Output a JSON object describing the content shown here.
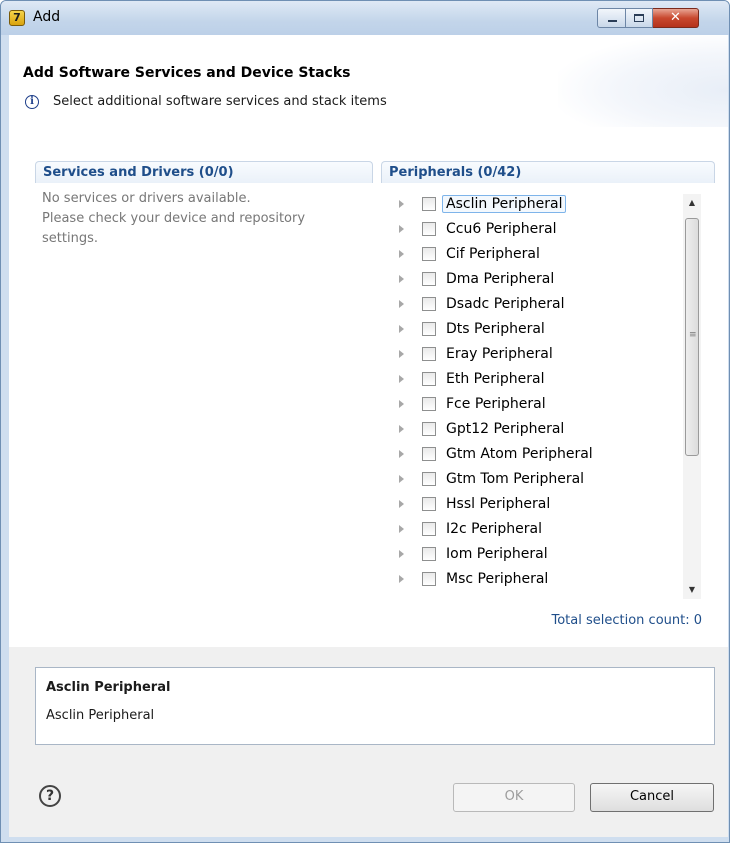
{
  "window": {
    "title": "Add",
    "app_icon_glyph": "7",
    "controls": {
      "minimize_icon": "minimize-icon",
      "maximize_icon": "maximize-icon",
      "close_icon": "close-icon",
      "close_glyph": "✕"
    }
  },
  "header": {
    "title": "Add Software Services and Device Stacks",
    "info_icon": "info-icon",
    "info_glyph": "i",
    "message": "Select additional software services and stack items"
  },
  "services_panel": {
    "title": "Services and Drivers (0/0)",
    "empty_lines": [
      "No services or drivers available.",
      "Please check your device and repository",
      "settings."
    ]
  },
  "peripherals_panel": {
    "title": "Peripherals (0/42)",
    "items": [
      {
        "label": "Asclin Peripheral",
        "checked": false,
        "selected": true
      },
      {
        "label": "Ccu6 Peripheral",
        "checked": false
      },
      {
        "label": "Cif Peripheral",
        "checked": false
      },
      {
        "label": "Dma Peripheral",
        "checked": false
      },
      {
        "label": "Dsadc Peripheral",
        "checked": false
      },
      {
        "label": "Dts Peripheral",
        "checked": false
      },
      {
        "label": "Eray Peripheral",
        "checked": false
      },
      {
        "label": "Eth Peripheral",
        "checked": false
      },
      {
        "label": "Fce Peripheral",
        "checked": false
      },
      {
        "label": "Gpt12 Peripheral",
        "checked": false
      },
      {
        "label": "Gtm Atom Peripheral",
        "checked": false
      },
      {
        "label": "Gtm Tom Peripheral",
        "checked": false
      },
      {
        "label": "Hssl Peripheral",
        "checked": false
      },
      {
        "label": "I2c Peripheral",
        "checked": false
      },
      {
        "label": "Iom Peripheral",
        "checked": false
      },
      {
        "label": "Msc Peripheral",
        "checked": false
      }
    ],
    "scrollbar": {
      "up_glyph": "▲",
      "down_glyph": "▼",
      "grip_glyph": "≡"
    }
  },
  "total_selection": "Total selection count: 0",
  "description": {
    "title": "Asclin Peripheral",
    "text": "Asclin Peripheral"
  },
  "footer": {
    "help_icon": "help-icon",
    "help_glyph": "?",
    "ok_label": "OK",
    "ok_enabled": false,
    "cancel_label": "Cancel"
  },
  "colors": {
    "link_blue": "#1f4e8a",
    "selection_border": "#7eb4ea",
    "close_red": "#c8482e"
  }
}
